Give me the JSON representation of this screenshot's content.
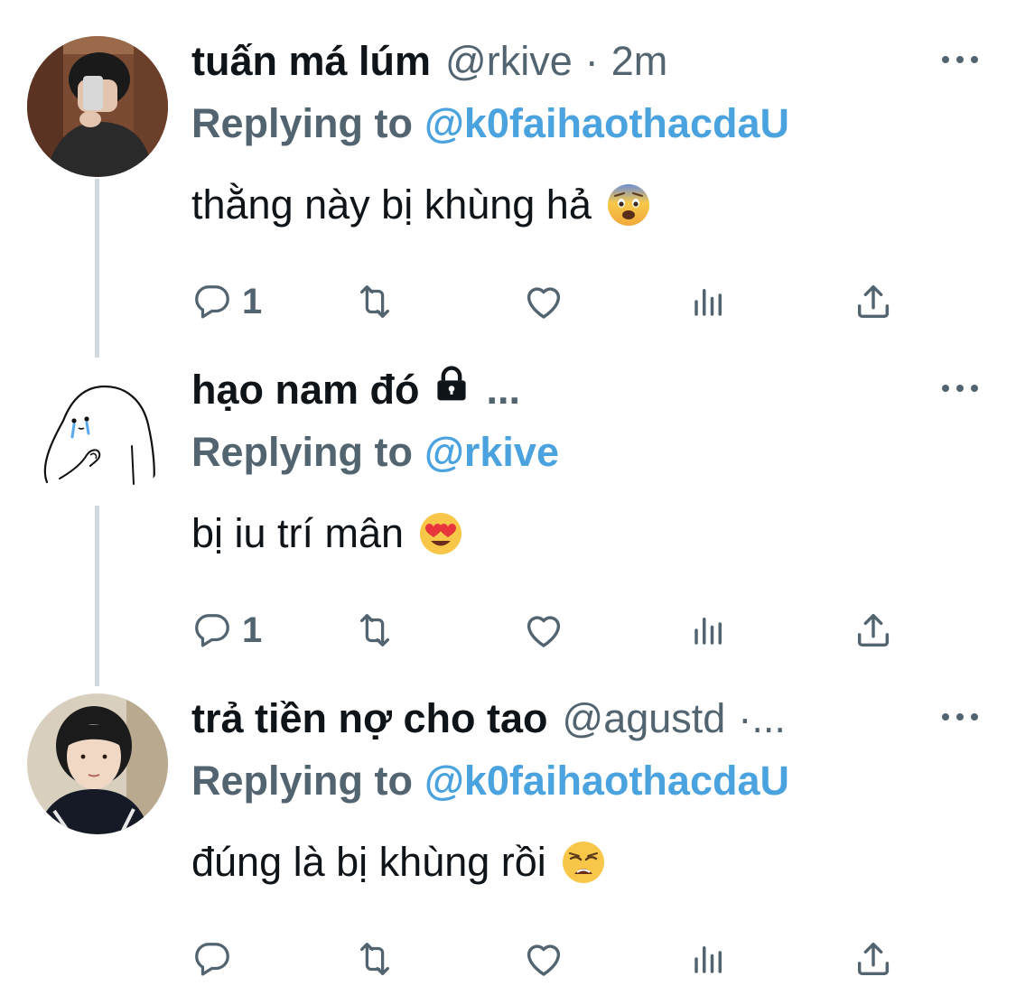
{
  "tweets": [
    {
      "display_name": "tuấn má lúm",
      "handle": "@rkive",
      "separator": "·",
      "time": "2m",
      "reply_prefix": "Replying to",
      "reply_to": "@k0faihaothacdaU",
      "text": "thằng này bị khùng hả",
      "emoji": "fearful-face",
      "reply_count": "1",
      "avatar": "mirror-selfie-photo"
    },
    {
      "display_name": "hạo nam đó",
      "locked": true,
      "truncation": "...",
      "reply_prefix": "Replying to",
      "reply_to": "@rkive",
      "text": "bị iu trí mân",
      "emoji": "heart-eyes-face",
      "reply_count": "1",
      "avatar": "crying-ghost-drawing"
    },
    {
      "display_name": "trả tiền nợ cho tao",
      "handle": "@agustd",
      "truncation": "·...",
      "reply_prefix": "Replying to",
      "reply_to": "@k0faihaothacdaU",
      "text": "đúng là bị khùng rồi",
      "emoji": "weary-face",
      "reply_count": "",
      "avatar": "portrait-photo"
    }
  ],
  "colors": {
    "text": "#0f1419",
    "secondary": "#536471",
    "mention": "#4aa3df",
    "thread_line": "#cfd9de"
  },
  "icons": [
    "reply-icon",
    "retweet-icon",
    "like-icon",
    "views-icon",
    "share-icon",
    "more-icon",
    "lock-icon"
  ]
}
